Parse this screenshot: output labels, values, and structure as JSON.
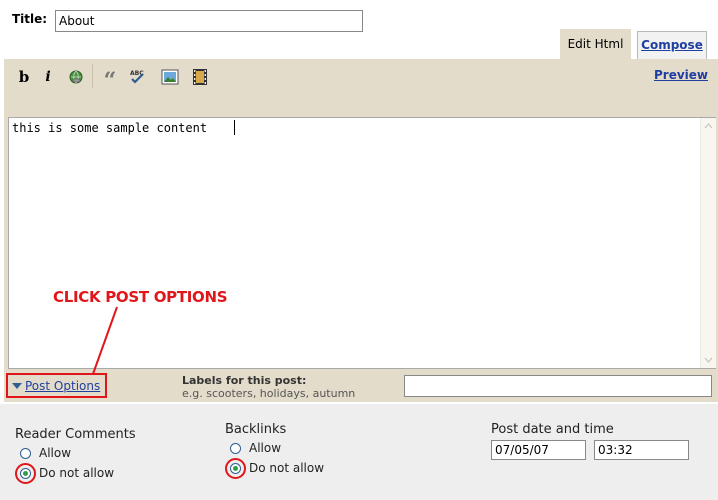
{
  "title_field": {
    "label": "Title:",
    "value": "About"
  },
  "tabs": [
    {
      "label": "Edit Html",
      "active": true
    },
    {
      "label": "Compose",
      "active": false
    }
  ],
  "toolbar": {
    "buttons": [
      {
        "name": "bold-button",
        "glyph": "b"
      },
      {
        "name": "italic-button",
        "glyph": "i"
      },
      {
        "name": "link-button",
        "icon": "link-globe-icon"
      },
      {
        "name": "blockquote-button",
        "glyph": "“"
      },
      {
        "name": "spellcheck-button",
        "glyph": "ABC"
      },
      {
        "name": "image-button",
        "icon": "image-icon"
      },
      {
        "name": "video-button",
        "icon": "film-icon"
      }
    ],
    "preview_label": "Preview"
  },
  "editor": {
    "content": "this is some sample content"
  },
  "annotation": {
    "text": "CLICK POST OPTIONS"
  },
  "post_options": {
    "label": "Post Options"
  },
  "labels": {
    "title": "Labels for this post:",
    "hint": "e.g. scooters, holidays, autumn",
    "value": ""
  },
  "reader_comments": {
    "title": "Reader Comments",
    "options": [
      {
        "label": "Allow",
        "checked": false
      },
      {
        "label": "Do not allow",
        "checked": true
      }
    ]
  },
  "backlinks": {
    "title": "Backlinks",
    "options": [
      {
        "label": "Allow",
        "checked": false
      },
      {
        "label": "Do not allow",
        "checked": true
      }
    ]
  },
  "post_date_time": {
    "title": "Post date and time",
    "date": "07/05/07",
    "time": "03:32"
  },
  "colors": {
    "editor_bg": "#e4dccb",
    "link": "#1f3fa0",
    "highlight": "#e0161a",
    "panel": "#eeeeee"
  }
}
